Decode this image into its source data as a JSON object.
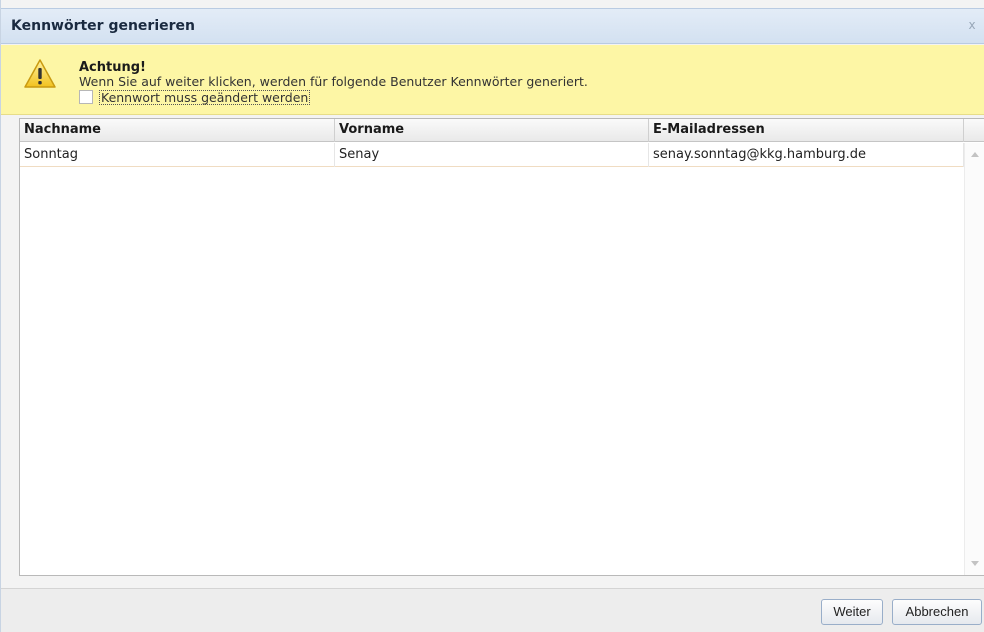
{
  "dialog": {
    "title": "Kennwörter generieren",
    "close_label": "x"
  },
  "warning": {
    "icon": "warning-triangle-icon",
    "title": "Achtung!",
    "text": "Wenn Sie auf weiter klicken, werden für folgende Benutzer Kennwörter generiert.",
    "checkbox_label": "Kennwort muss geändert werden",
    "checkbox_checked": false
  },
  "grid": {
    "columns": [
      "Nachname",
      "Vorname",
      "E-Mailadressen"
    ],
    "rows": [
      [
        "Sonntag",
        "Senay",
        "senay.sonntag@kkg.hamburg.de"
      ]
    ]
  },
  "footer": {
    "next_label": "Weiter",
    "cancel_label": "Abbrechen"
  },
  "colors": {
    "titlebar": "#d3e1f1",
    "warning_bg": "#fdf6a5",
    "button_border": "#99aec9"
  }
}
